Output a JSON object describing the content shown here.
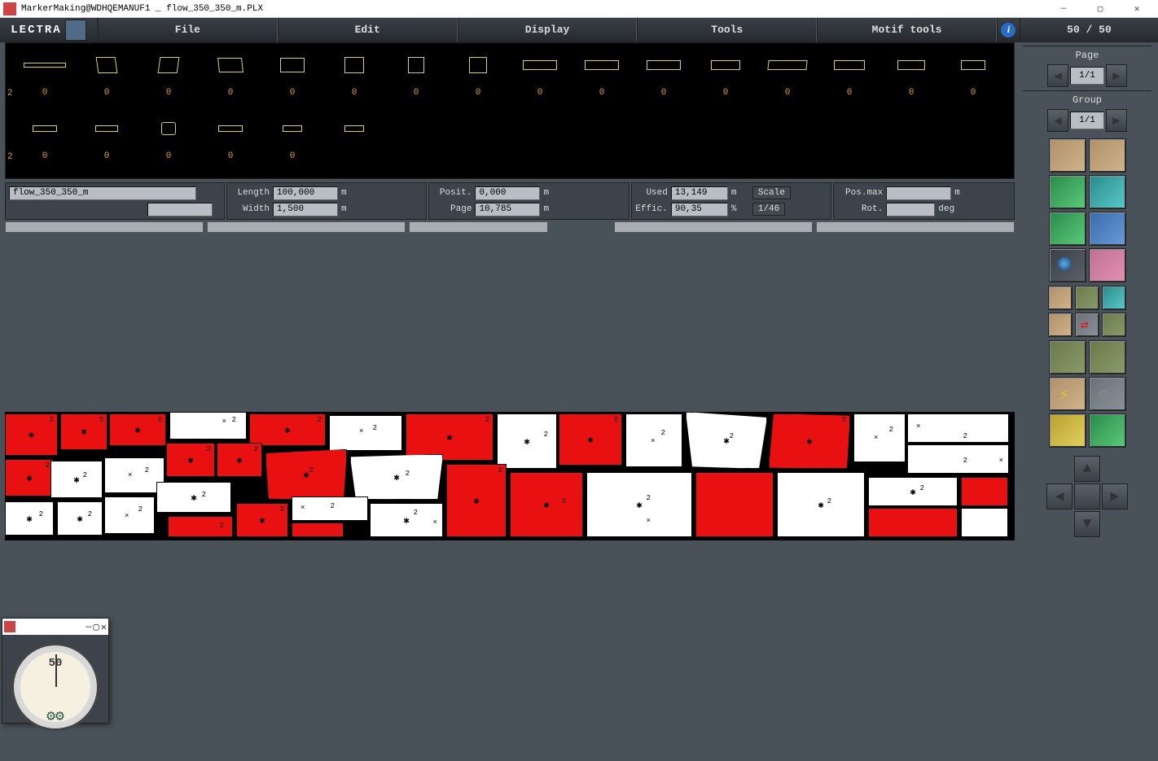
{
  "window": {
    "title": "MarkerMaking@WDHQEMANUF1 _ flow_350_350_m.PLX"
  },
  "brand": "LECTRA",
  "menu": {
    "file": "File",
    "edit": "Edit",
    "display": "Display",
    "tools": "Tools",
    "motif_tools": "Motif tools"
  },
  "counter": "50 / 50",
  "nav": {
    "page_label": "Page",
    "page_value": "1/1",
    "group_label": "Group",
    "group_value": "1/1"
  },
  "info": {
    "marker_name": "flow_350_350_m",
    "length_label": "Length",
    "length_value": "100,000",
    "length_unit": "m",
    "width_label": "Width",
    "width_value": "1,500",
    "width_unit": "m",
    "posit_label": "Posit.",
    "posit_value": "0,000",
    "posit_unit": "m",
    "page_label": "Page",
    "page_value": "10,785",
    "page_unit": "m",
    "used_label": "Used",
    "used_value": "13,149",
    "used_unit": "m",
    "effic_label": "Effic.",
    "effic_value": "90,35",
    "effic_unit": "%",
    "scale_label": "Scale",
    "scale_value": "1/46",
    "posmax_label": "Pos.max",
    "posmax_value": "",
    "posmax_unit": "m",
    "rot_label": "Rot.",
    "rot_value": "",
    "rot_unit": "deg"
  },
  "bin": {
    "edge1": "2",
    "edge2": "2",
    "row1_counts": [
      "0",
      "0",
      "0",
      "0",
      "0",
      "0",
      "0",
      "0",
      "0",
      "0",
      "0",
      "0",
      "0",
      "0",
      "0",
      "0"
    ],
    "row2_counts": [
      "0",
      "0",
      "0",
      "0",
      "0"
    ]
  },
  "gauge": {
    "value": "50"
  },
  "tool_tips": [
    "arrange-up",
    "arrange-down",
    "align-left",
    "align-variant",
    "rotate",
    "flip",
    "zoom",
    "move",
    "grid-a",
    "grid-b",
    "grid-c",
    "step-a",
    "swap",
    "step-b",
    "opt-a",
    "opt-b",
    "auto-a",
    "auto-b",
    "spec-a",
    "spec-b"
  ]
}
